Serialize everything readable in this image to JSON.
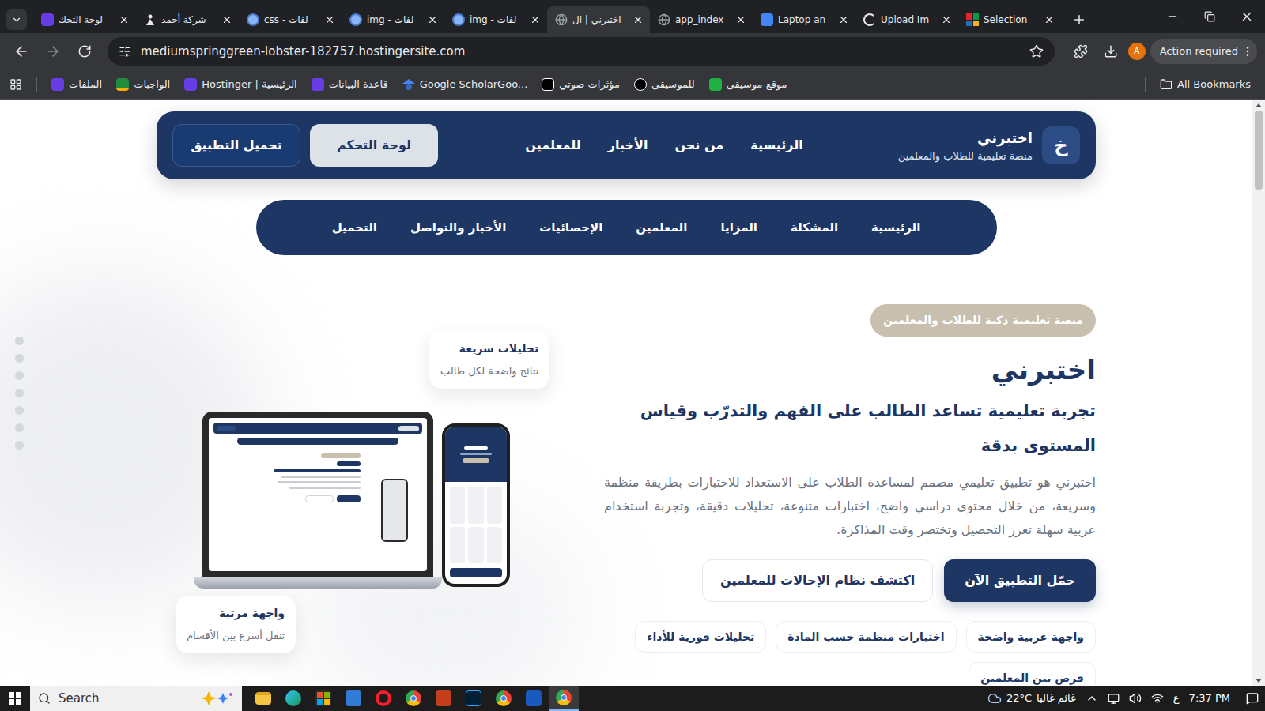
{
  "browser": {
    "tabs": [
      {
        "label": "لوحة التحك",
        "kind": "hostinger",
        "selected": false
      },
      {
        "label": "شركة أحمد",
        "kind": "person",
        "selected": false
      },
      {
        "label": "css - لفات",
        "kind": "globe",
        "selected": false
      },
      {
        "label": "img - لفات",
        "kind": "globe",
        "selected": false
      },
      {
        "label": "img - لفات",
        "kind": "globe",
        "selected": false
      },
      {
        "label": "اختبرني | ال",
        "kind": "site",
        "selected": true
      },
      {
        "label": "app_index",
        "kind": "site",
        "selected": false
      },
      {
        "label": "Laptop an",
        "kind": "doc",
        "selected": false
      },
      {
        "label": "Upload Im",
        "kind": "loader",
        "selected": false
      },
      {
        "label": "Selection",
        "kind": "zoho",
        "selected": false
      }
    ],
    "url": "mediumspringgreen-lobster-182757.hostingersite.com",
    "profile_initial": "A",
    "action_label": "Action required",
    "bookmarks": [
      {
        "label": "الملفات",
        "kind": "hostinger"
      },
      {
        "label": "الواجبات",
        "kind": "classroom"
      },
      {
        "label": "Hostinger | الرئيسية",
        "kind": "hostinger"
      },
      {
        "label": "قاعدة البيانات",
        "kind": "hostinger"
      },
      {
        "label": "Google ScholarGoo...",
        "kind": "scholar"
      },
      {
        "label": "مؤثرات صوتي",
        "kind": "dark"
      },
      {
        "label": "للموسيقى",
        "kind": "circle"
      },
      {
        "label": "موقع موسيقى",
        "kind": "px"
      }
    ],
    "all_bookmarks": "All Bookmarks"
  },
  "site": {
    "brand": {
      "logo": "خ",
      "name": "اختبرني",
      "tagline": "منصة تعليمية للطلاب والمعلمين"
    },
    "nav_links": [
      "الرئيسية",
      "من نحن",
      "الأخبار",
      "للمعلمين"
    ],
    "dashboard_button": "لوحة التحكم",
    "download_button": "تحميل التطبيق",
    "section_nav": [
      "الرئيسية",
      "المشكلة",
      "المزايا",
      "المعلمين",
      "الإحصائيات",
      "الأخبار والتواصل",
      "التحميل"
    ],
    "section_dots": [
      {
        "selected": false
      },
      {
        "selected": false
      },
      {
        "selected": false
      },
      {
        "selected": false
      },
      {
        "selected": false
      },
      {
        "selected": false
      },
      {
        "selected": false
      }
    ],
    "hero": {
      "badge": "منصة تعليمية ذكية للطلاب والمعلمين",
      "title": "اختبرني",
      "subtitle": "تجربة تعليمية تساعد الطالب على الفهم والتدرّب وقياس المستوى بدقة",
      "description": "اختبرني هو تطبيق تعليمي مصمم لمساعدة الطلاب على الاستعداد للاختبارات بطريقة منظمة وسريعة، من خلال محتوى دراسي واضح، اختبارات متنوعة، تحليلات دقيقة، وتجربة استخدام عربية سهلة تعزز التحصيل وتختصر وقت المذاكرة.",
      "primary_button": "حمّل التطبيق الآن",
      "secondary_button": "اكتشف نظام الإحالات للمعلمين",
      "tags": [
        "واجهة عربية واضحة",
        "اختبارات منظمة حسب المادة",
        "تحليلات فورية للأداء",
        "فرص بين المعلمين"
      ],
      "floating_cards": [
        {
          "title": "تحليلات سريعة",
          "subtitle": "نتائج واضحة لكل طالب"
        },
        {
          "title": "واجهة مرتبة",
          "subtitle": "تنقل أسرع بين الأقسام"
        }
      ]
    }
  },
  "taskbar": {
    "search_placeholder": "Search",
    "apps": [
      {
        "kind": "explorer",
        "selected": false
      },
      {
        "kind": "edge",
        "selected": false
      },
      {
        "kind": "store",
        "selected": false
      },
      {
        "kind": "mail",
        "selected": false
      },
      {
        "kind": "opera",
        "selected": false
      },
      {
        "kind": "chrome",
        "selected": false
      },
      {
        "kind": "powerpoint",
        "selected": false
      },
      {
        "kind": "photoshop",
        "selected": false
      },
      {
        "kind": "chrome",
        "selected": false
      },
      {
        "kind": "word",
        "selected": false
      },
      {
        "kind": "chrome",
        "selected": true
      }
    ],
    "weather": {
      "temp": "22°C",
      "condition": "غائم غالبا"
    },
    "input_language": "ع",
    "time": "7:37 PM"
  }
}
